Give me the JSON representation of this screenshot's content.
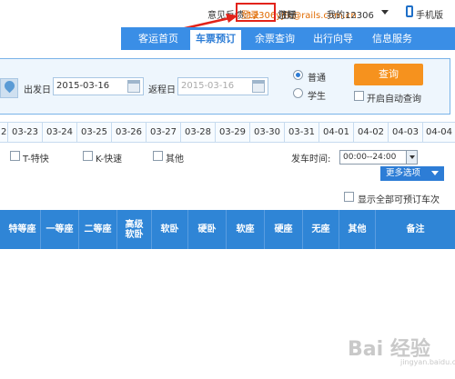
{
  "topbar": {
    "feedback_label": "意见反馈:",
    "feedback_email": "12306yjfk@rails.com.cn",
    "greeting": "您好",
    "please": "请",
    "login": "登录",
    "register": "注册",
    "my12306": "我的12306",
    "mobile": "手机版"
  },
  "nav": {
    "items": [
      "客运首页",
      "车票预订",
      "余票查询",
      "出行向导",
      "信息服务"
    ],
    "active": "车票预订"
  },
  "search": {
    "depart_label": "出发日",
    "depart_date": "2015-03-16",
    "return_label": "返程日",
    "return_date": "2015-03-16",
    "type_normal": "普通",
    "type_student": "学生",
    "query_button": "查询",
    "auto_query": "开启自动查询"
  },
  "dates": [
    "2",
    "03-23",
    "03-24",
    "03-25",
    "03-26",
    "03-27",
    "03-28",
    "03-29",
    "03-30",
    "03-31",
    "04-01",
    "04-02",
    "04-03",
    "04-04"
  ],
  "filters": {
    "t_train": "T-特快",
    "k_train": "K-快速",
    "other": "其他",
    "depart_time_label": "发车时间:",
    "depart_time_value": "00:00--24:00",
    "more_options": "更多选项"
  },
  "show_all": "显示全部可预订车次",
  "table_headers": [
    "特等座",
    "一等座",
    "二等座",
    "高级软卧",
    "软卧",
    "硬卧",
    "软座",
    "硬座",
    "无座",
    "其他",
    "备注"
  ],
  "watermark": "Bai 经验",
  "watermark_sub": "jingyan.baidu.com",
  "colors": {
    "nav_blue": "#3a8ee6",
    "accent_orange": "#f6921e",
    "link_orange": "#e06a00",
    "highlight_red": "#e2231a",
    "header_blue": "#2f85d6"
  }
}
